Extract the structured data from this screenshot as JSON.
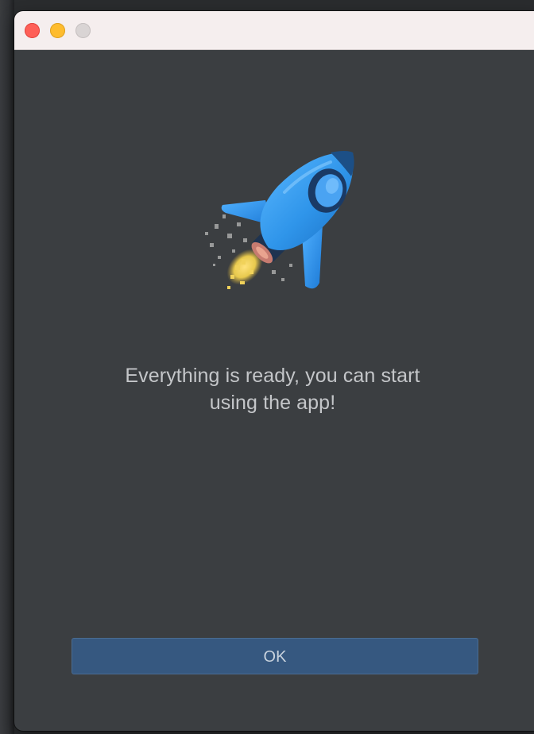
{
  "window": {
    "controls": [
      "close",
      "minimize",
      "maximize"
    ]
  },
  "illustration": {
    "icon": "rocket-icon"
  },
  "message": {
    "line1": "Everything is ready, you can start",
    "line2": "using the app!"
  },
  "actions": {
    "ok_label": "OK"
  },
  "colors": {
    "background": "#3b3e41",
    "titlebar": "#f5eeee",
    "close": "#fe5f57",
    "minimize": "#febc2e",
    "maximize": "#d9d4d4",
    "button": "#365880",
    "text": "#c4c6c9",
    "rocket": "#2f95ea"
  }
}
